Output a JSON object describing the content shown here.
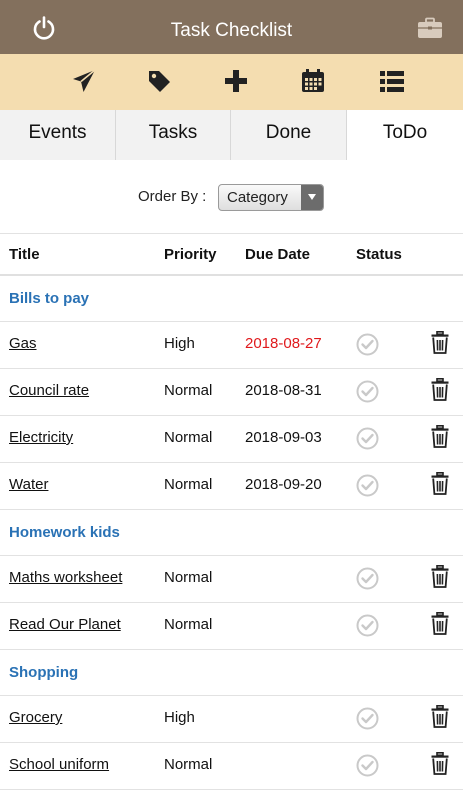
{
  "app": {
    "title": "Task Checklist"
  },
  "toolbar": {
    "icons": [
      "send-icon",
      "tag-icon",
      "plus-icon",
      "calendar-icon",
      "list-icon"
    ]
  },
  "tabs": [
    {
      "label": "Events",
      "active": false
    },
    {
      "label": "Tasks",
      "active": false
    },
    {
      "label": "Done",
      "active": false
    },
    {
      "label": "ToDo",
      "active": true
    }
  ],
  "order": {
    "label": "Order By :",
    "value": "Category"
  },
  "columns": {
    "title": "Title",
    "priority": "Priority",
    "due": "Due Date",
    "status": "Status"
  },
  "colors": {
    "titlebar": "#83705d",
    "toolbar": "#f4ddb0",
    "group": "#2a72b5",
    "overdue": "#e0191c"
  },
  "groups": [
    {
      "name": "Bills to pay",
      "tasks": [
        {
          "title": "Gas",
          "priority": "High",
          "due": "2018-08-27",
          "overdue": true
        },
        {
          "title": "Council rate",
          "priority": "Normal",
          "due": "2018-08-31"
        },
        {
          "title": "Electricity",
          "priority": "Normal",
          "due": "2018-09-03"
        },
        {
          "title": "Water",
          "priority": "Normal",
          "due": "2018-09-20"
        }
      ]
    },
    {
      "name": "Homework kids",
      "tasks": [
        {
          "title": "Maths worksheet",
          "priority": "Normal",
          "due": ""
        },
        {
          "title": "Read Our Planet",
          "priority": "Normal",
          "due": ""
        }
      ]
    },
    {
      "name": "Shopping",
      "tasks": [
        {
          "title": "Grocery",
          "priority": "High",
          "due": ""
        },
        {
          "title": "School uniform",
          "priority": "Normal",
          "due": ""
        }
      ]
    }
  ]
}
